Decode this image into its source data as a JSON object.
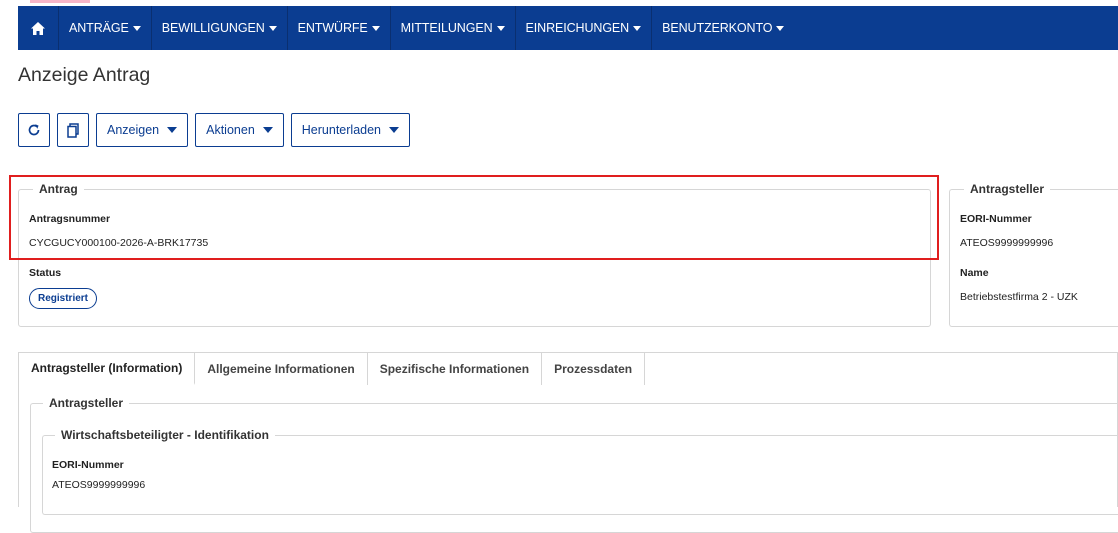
{
  "nav": {
    "home_icon": "home-icon",
    "items": [
      {
        "label": "ANTRÄGE"
      },
      {
        "label": "BEWILLIGUNGEN"
      },
      {
        "label": "ENTWÜRFE"
      },
      {
        "label": "MITTEILUNGEN"
      },
      {
        "label": "EINREICHUNGEN"
      },
      {
        "label": "BENUTZERKONTO"
      }
    ],
    "color": "#0b3d91"
  },
  "page": {
    "title": "Anzeige Antrag"
  },
  "toolbar": {
    "refresh_icon": "refresh-icon",
    "copy_icon": "copy-icon",
    "anzeigen": "Anzeigen",
    "aktionen": "Aktionen",
    "herunterladen": "Herunterladen"
  },
  "antrag": {
    "legend": "Antrag",
    "number_label": "Antragsnummer",
    "number_value": "CYCGUCY000100-2026-A-BRK17735",
    "status_label": "Status",
    "status_value": "Registriert"
  },
  "antragsteller_box": {
    "legend": "Antragsteller",
    "eori_label": "EORI-Nummer",
    "eori_value": "ATEOS9999999996",
    "name_label": "Name",
    "name_value": "Betriebstestfirma 2 - UZK"
  },
  "tabs": [
    {
      "label": "Antragsteller (Information)",
      "active": true
    },
    {
      "label": "Allgemeine Informationen",
      "active": false
    },
    {
      "label": "Spezifische Informationen",
      "active": false
    },
    {
      "label": "Prozessdaten",
      "active": false
    }
  ],
  "tab_content": {
    "section_legend": "Antragsteller",
    "sub_legend": "Wirtschaftsbeteiligter - Identifikation",
    "eori_label": "EORI-Nummer",
    "eori_value": "ATEOS9999999996"
  },
  "highlight_color": "#e01e1e"
}
